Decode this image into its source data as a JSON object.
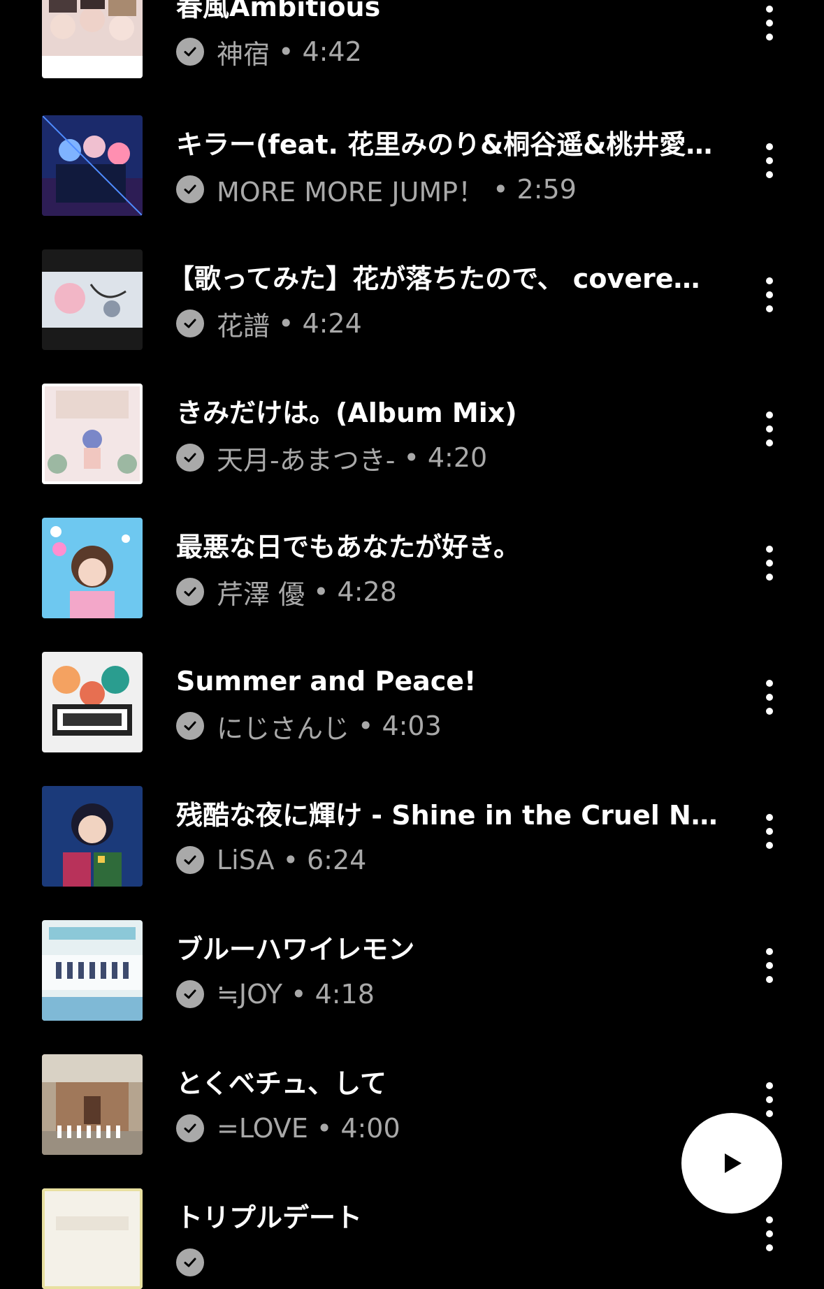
{
  "tracks": [
    {
      "title": "春風Ambitious",
      "artist": "神宿",
      "separator": "•",
      "duration": "4:42"
    },
    {
      "title": "キラー(feat. 花里みのり&桐谷遥&桃井愛…",
      "artist": "MORE MORE JUMP！",
      "separator": "•",
      "duration": "2:59"
    },
    {
      "title": "【歌ってみた】花が落ちたので、 covered…",
      "artist": "花譜",
      "separator": "•",
      "duration": "4:24"
    },
    {
      "title": "きみだけは。(Album Mix)",
      "artist": "天月-あまつき-",
      "separator": "•",
      "duration": "4:20"
    },
    {
      "title": "最悪な日でもあなたが好き。",
      "artist": "芹澤 優",
      "separator": "•",
      "duration": "4:28"
    },
    {
      "title": "Summer and Peace!",
      "artist": "にじさんじ",
      "separator": "•",
      "duration": "4:03"
    },
    {
      "title": "残酷な夜に輝け - Shine in the Cruel Ni…",
      "artist": "LiSA",
      "separator": "•",
      "duration": "6:24"
    },
    {
      "title": "ブルーハワイレモン",
      "artist": "≒JOY",
      "separator": "•",
      "duration": "4:18"
    },
    {
      "title": "とくベチュ、して",
      "artist": "=LOVE",
      "separator": "•",
      "duration": "4:00"
    },
    {
      "title": "トリプルデート",
      "artist": "",
      "separator": "",
      "duration": ""
    }
  ],
  "icons": {
    "downloaded": "check-circle-icon",
    "more": "more-vertical-icon",
    "play": "play-icon"
  },
  "colors": {
    "background": "#000000",
    "title": "#ffffff",
    "subtitle": "#a9a9a9",
    "fab": "#ffffff"
  }
}
